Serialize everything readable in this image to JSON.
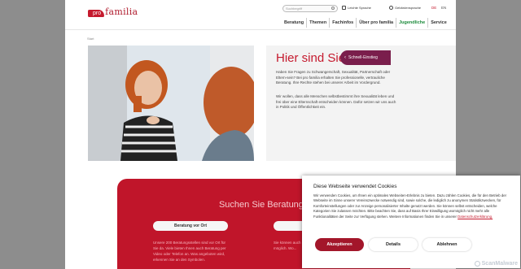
{
  "header": {
    "logo_pro": "pro",
    "logo_familia": "familia",
    "search_placeholder": "Suchbegriff",
    "util_leichte_sprache": "Leichte Sprache",
    "util_gebaerdensprache": "Gebärdensprache",
    "lang_de": "DE",
    "lang_en": "EN"
  },
  "nav": {
    "items": [
      "Beratung",
      "Themen",
      "Fachinfos",
      "Über pro familia",
      "Jugendliche",
      "Service"
    ]
  },
  "breadcrumb": "Start",
  "hero": {
    "title": "Hier sind Sie richtig!",
    "para1": "Haben Sie Fragen zu Schwangerschaft, Sexualität, Partnerschaft oder Eltern-sein? Bei pro familia erhalten Sie professionelle, vertrauliche Beratung. Ihre Rechte stehen bei unserer Arbeit im Vordergrund.",
    "para2": "Wir wollen, dass alle Menschen selbstbestimmt ihre Sexualität leben und frei über eine Elternschaft entscheiden können. Dafür setzen wir uns auch in Politik und Öffentlichkeit ein.",
    "schnell_label": "Schnell-Einstieg"
  },
  "beratung": {
    "title": "Suchen Sie Beratung?",
    "button_ort": "Beratung vor Ort",
    "text_left": "Unsere 200 Beratungsstellen sind vor Ort für Sie da. Viele bieten Ihnen auch Beratung per Video oder Telefon an. Was angeboten wird, erkennen Sie an den Symbolen.",
    "text_right": "Sie können auch Beratung schriftlich möglich. Wo..."
  },
  "cookie": {
    "title": "Diese Webseite verwendet Cookies",
    "text": "Wir verwenden Cookies, um Ihnen ein optimales Webseiten-Erlebnis zu bieten. Dazu zählen Cookies, die für den Betrieb der Webseite im Sinne unserer Vereinszwecke notwendig sind, sowie solche, die lediglich zu anonymen Statistikzwecken, für Komforteinstellungen oder zur Anzeige personalisierter Inhalte genutzt werden. Sie können selbst entscheiden, welche Kategorien Sie zulassen möchten. Bitte beachten Sie, dass auf Basis Ihrer Einwilligung womöglich nicht mehr alle Funktionalitäten der Seite zur Verfügung stehen. Weitere Informationen finden Sie in unserer",
    "link": "Datenschutzerklärung.",
    "btn_accept": "Akzeptieren",
    "btn_details": "Details",
    "btn_reject": "Ablehnen",
    "watermark": "ScanMalware"
  },
  "colors": {
    "brand_red": "#c51a2e",
    "plum": "#7a1e4c",
    "green": "#1b8a3a"
  }
}
